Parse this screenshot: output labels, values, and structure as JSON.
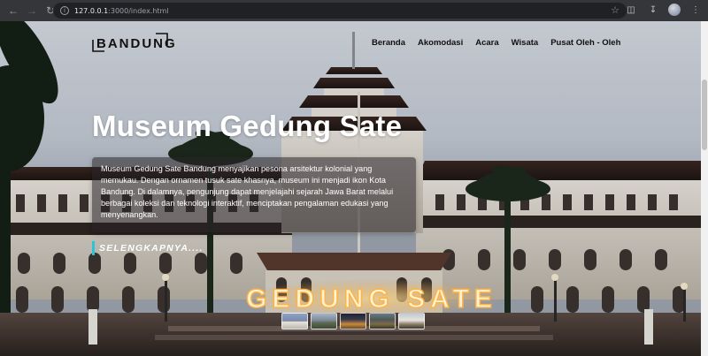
{
  "browser": {
    "url_host": "127.0.0.1",
    "url_path": ":3000/index.html"
  },
  "header": {
    "logo_text": "BANDUNG",
    "nav": [
      "Beranda",
      "Akomodasi",
      "Acara",
      "Wisata",
      "Pusat Oleh - Oleh"
    ]
  },
  "hero": {
    "title": "Museum Gedung Sate",
    "description": "Museum Gedung Sate Bandung menyajikan pesona arsitektur kolonial yang memukau. Dengan ornamen tusuk sate khasnya, museum ini menjadi ikon Kota Bandung. Di dalamnya, pengunjung dapat menjelajahi sejarah Jawa Barat melalui berbagai koleksi dan teknologi interaktif, menciptakan pengalaman edukasi yang menyenangkan.",
    "read_more": "SELENGKAPNYA....",
    "sign_text": "GEDUNG SATE"
  },
  "thumbnails": 5,
  "colors": {
    "accent": "#28c6d1",
    "sign_glow": "#ffd27a"
  }
}
